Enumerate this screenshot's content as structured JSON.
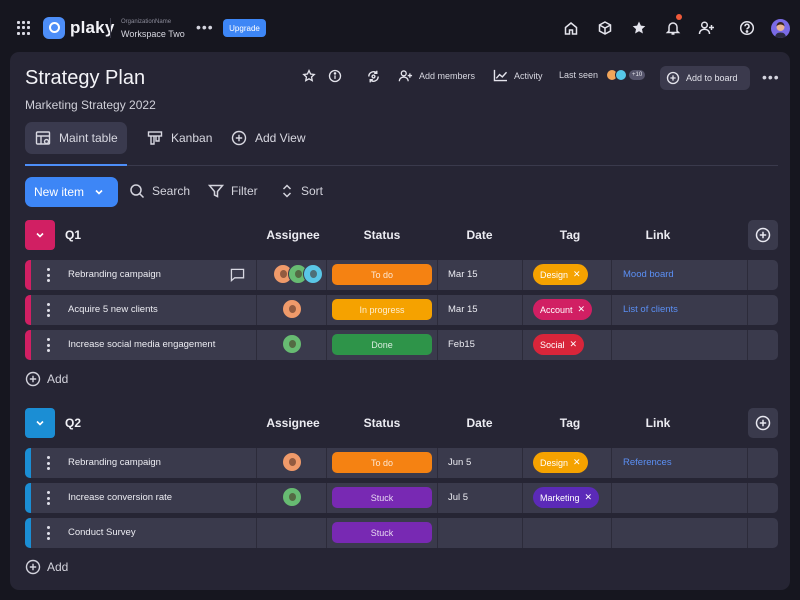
{
  "topbar": {
    "app_name": "plaky",
    "org_label": "OrganizationName",
    "workspace": "Workspace Two",
    "upgrade_label": "Upgrade"
  },
  "board": {
    "title": "Strategy Plan",
    "subtitle": "Marketing Strategy 2022",
    "add_members": "Add members",
    "activity": "Activity",
    "last_seen": "Last seen",
    "last_seen_count": "+10",
    "add_to_board": "Add to board"
  },
  "views": {
    "tabs": [
      {
        "label": "Maint table",
        "icon": "table-icon",
        "active": true
      },
      {
        "label": "Kanban",
        "icon": "kanban-icon",
        "active": false
      },
      {
        "label": "Add View",
        "icon": "plus-circle-icon",
        "active": false
      }
    ]
  },
  "toolbar": {
    "new_item": "New item",
    "search": "Search",
    "filter": "Filter",
    "sort": "Sort"
  },
  "columns": {
    "assignee": "Assignee",
    "status": "Status",
    "date": "Date",
    "tag": "Tag",
    "link": "Link"
  },
  "colors": {
    "accent": "#3d86f6",
    "q1": "#d11f63",
    "q2": "#1b8ed4",
    "todo": "#f58212",
    "in_progress": "#f5a200",
    "done": "#2e9449",
    "stuck": "#7829b3"
  },
  "groups": [
    {
      "name": "Q1",
      "add_label": "Add",
      "rows": [
        {
          "name": "Rebranding campaign",
          "status": "To do",
          "date": "Mar 15",
          "tag": "Design",
          "link": "Mood board"
        },
        {
          "name": "Acquire 5 new clients",
          "status": "In progress",
          "date": "Mar 15",
          "tag": "Account",
          "link": "List of clients"
        },
        {
          "name": "Increase social media engagement",
          "status": "Done",
          "date": "Feb15",
          "tag": "Social",
          "link": ""
        }
      ]
    },
    {
      "name": "Q2",
      "add_label": "Add",
      "rows": [
        {
          "name": "Rebranding campaign",
          "status": "To do",
          "date": "Jun 5",
          "tag": "Design",
          "link": "References"
        },
        {
          "name": "Increase conversion rate",
          "status": "Stuck",
          "date": "Jul 5",
          "tag": "Marketing",
          "link": ""
        },
        {
          "name": "Conduct Survey",
          "status": "Stuck",
          "date": "",
          "tag": "",
          "link": ""
        }
      ]
    }
  ]
}
